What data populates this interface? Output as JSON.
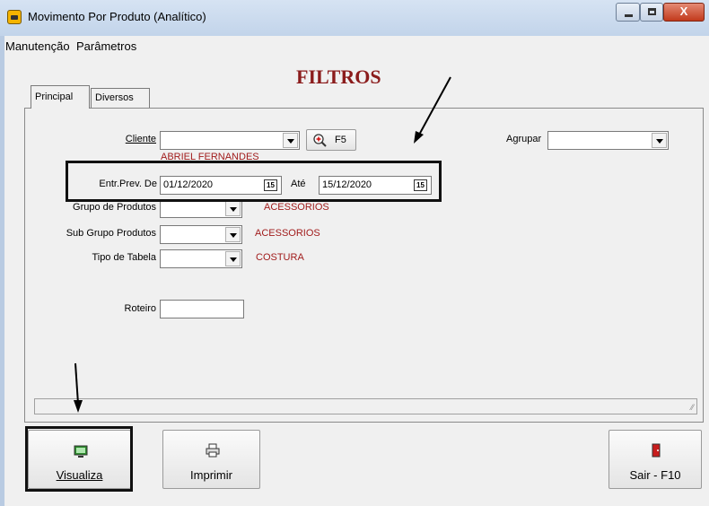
{
  "window": {
    "title": "Movimento Por Produto (Analítico)",
    "controls": {
      "minimize": "–",
      "maximize": "□",
      "close": "X"
    }
  },
  "menu": {
    "items": [
      "Manutenção",
      "Parâmetros"
    ]
  },
  "form_title": "FILTROS",
  "tabs": [
    {
      "label": "Principal"
    },
    {
      "label": "Diversos"
    }
  ],
  "cliente": {
    "label": "Cliente",
    "value": "",
    "search_button": "F5",
    "hint": "ABRIEL FERNANDES"
  },
  "agrupar": {
    "label": "Agrupar",
    "value": ""
  },
  "entr_prev": {
    "label": "Entr.Prev. De",
    "from": "01/12/2020",
    "to_label": "Até",
    "to": "15/12/2020",
    "calendar_glyph": "15"
  },
  "grupo_produtos": {
    "label": "Grupo de Produtos",
    "value": "",
    "desc": "ACESSORIOS"
  },
  "sub_grupo": {
    "label": "Sub Grupo Produtos",
    "value": "",
    "desc": "ACESSORIOS"
  },
  "tipo_tabela": {
    "label": "Tipo de Tabela",
    "value": "",
    "desc": "COSTURA"
  },
  "roteiro": {
    "label": "Roteiro",
    "value": ""
  },
  "buttons": {
    "visualiza": "Visualiza",
    "imprimir": "Imprimir",
    "sair": "Sair - F10"
  },
  "icons": {
    "app": "app-icon",
    "search": "magnifier-plus-icon",
    "visualiza": "monitor-icon",
    "imprimir": "printer-icon",
    "sair": "exit-door-icon"
  },
  "colors": {
    "title_red": "#8b1c1c",
    "desc_red": "#a11c1c",
    "window_frame": "#cfdcec",
    "close_button": "#c23a1c"
  }
}
